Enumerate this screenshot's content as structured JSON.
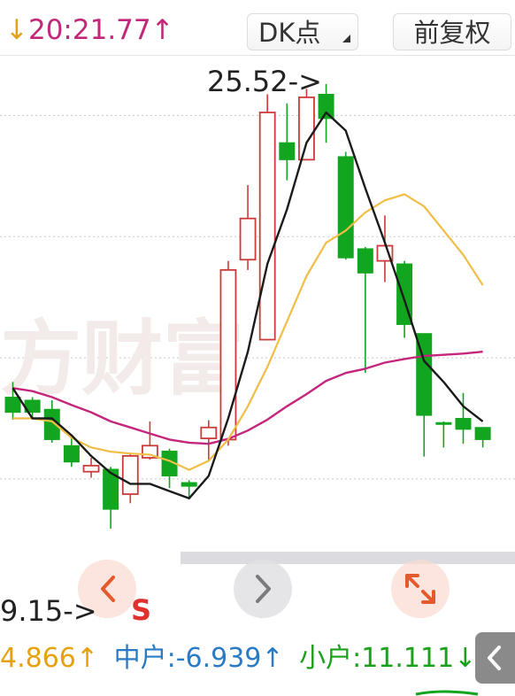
{
  "header": {
    "ma_arrow": "↓",
    "ma_value": "20:21.77",
    "ma_trend": "↑",
    "dk_label": "DK点",
    "adjust_label": "前复权"
  },
  "chart_data": {
    "type": "candlestick",
    "y_range": [
      17.8,
      26.0
    ],
    "gridlines": [
      25.0,
      23.0,
      21.0,
      19.0
    ],
    "max_label": "25.52->",
    "min_label": "9.15->",
    "up_color": "#cd3b3b",
    "down_color": "#12a51f",
    "candles": [
      {
        "o": 20.35,
        "c": 20.1,
        "h": 20.6,
        "l": 19.98
      },
      {
        "o": 20.3,
        "c": 20.1,
        "h": 20.35,
        "l": 20.0
      },
      {
        "o": 20.15,
        "c": 19.65,
        "h": 20.3,
        "l": 19.6
      },
      {
        "o": 19.55,
        "c": 19.28,
        "h": 19.72,
        "l": 19.2
      },
      {
        "o": 19.12,
        "c": 19.22,
        "h": 19.35,
        "l": 19.02
      },
      {
        "o": 19.16,
        "c": 18.5,
        "h": 19.2,
        "l": 18.18
      },
      {
        "o": 18.75,
        "c": 19.38,
        "h": 19.42,
        "l": 18.6
      },
      {
        "o": 19.35,
        "c": 19.55,
        "h": 19.95,
        "l": 19.32
      },
      {
        "o": 19.46,
        "c": 19.05,
        "h": 19.5,
        "l": 18.85
      },
      {
        "o": 18.94,
        "c": 18.88,
        "h": 18.98,
        "l": 18.7
      },
      {
        "o": 19.67,
        "c": 19.85,
        "h": 19.97,
        "l": 19.3
      },
      {
        "o": 19.65,
        "c": 22.45,
        "h": 22.6,
        "l": 19.55
      },
      {
        "o": 22.62,
        "c": 23.3,
        "h": 23.85,
        "l": 22.45
      },
      {
        "o": 21.3,
        "c": 25.05,
        "h": 25.35,
        "l": 21.3
      },
      {
        "o": 24.55,
        "c": 24.27,
        "h": 25.2,
        "l": 23.93
      },
      {
        "o": 24.27,
        "c": 25.3,
        "h": 25.44,
        "l": 24.27
      },
      {
        "o": 25.35,
        "c": 24.95,
        "h": 25.52,
        "l": 24.55
      },
      {
        "o": 24.32,
        "c": 22.65,
        "h": 24.4,
        "l": 22.62
      },
      {
        "o": 22.8,
        "c": 22.4,
        "h": 22.83,
        "l": 20.75
      },
      {
        "o": 22.6,
        "c": 22.85,
        "h": 23.35,
        "l": 22.25
      },
      {
        "o": 22.55,
        "c": 21.55,
        "h": 22.6,
        "l": 21.33
      },
      {
        "o": 21.4,
        "c": 20.05,
        "h": 21.4,
        "l": 19.37
      },
      {
        "o": 19.93,
        "c": 19.92,
        "h": 19.95,
        "l": 19.52
      },
      {
        "o": 20.0,
        "c": 19.82,
        "h": 20.42,
        "l": 19.58
      },
      {
        "o": 19.85,
        "c": 19.65,
        "h": 19.85,
        "l": 19.52
      }
    ],
    "ma_black": [
      20.5,
      20.0,
      20.0,
      19.72,
      19.38,
      19.1,
      18.92,
      18.92,
      18.8,
      18.68,
      19.05,
      20.0,
      21.1,
      22.55,
      23.45,
      24.55,
      25.05,
      24.75,
      23.8,
      22.9,
      21.95,
      20.95,
      20.6,
      20.2,
      19.95
    ],
    "ma_yellow": [
      20.0,
      20.0,
      19.95,
      19.68,
      19.52,
      19.45,
      19.42,
      19.4,
      19.3,
      19.15,
      19.3,
      19.65,
      20.2,
      20.85,
      21.6,
      22.35,
      22.9,
      23.1,
      23.4,
      23.6,
      23.7,
      23.5,
      23.1,
      22.7,
      22.2
    ],
    "ma_magenta": [
      20.5,
      20.45,
      20.35,
      20.22,
      20.1,
      19.95,
      19.85,
      19.75,
      19.65,
      19.6,
      19.58,
      19.66,
      19.8,
      19.98,
      20.2,
      20.4,
      20.62,
      20.75,
      20.82,
      20.92,
      20.98,
      21.03,
      21.05,
      21.07,
      21.1
    ]
  },
  "overlay": {
    "s_marker": "S",
    "watermark": "方财富"
  },
  "capital_flow": {
    "big_value": "4.866↑",
    "mid_label": "中户:",
    "mid_value": "-6.939↑",
    "small_label": "小户:",
    "small_value": "11.111↓"
  },
  "colors": {
    "ma_readout": "#c2287a",
    "ma_arrow": "#e1a21b",
    "big_flow": "#e6a20c",
    "mid_flow": "#2b7bc4",
    "small_flow": "#1aa01a",
    "grid": "#c8c8c8",
    "ma_black": "#1b1b1b",
    "ma_yellow": "#f0bd45",
    "ma_magenta": "#c4267c"
  },
  "icons": {
    "prev": "chevron-left-icon",
    "next": "chevron-right-icon",
    "expand": "expand-arrows-icon",
    "side": "chevron-left-icon"
  }
}
